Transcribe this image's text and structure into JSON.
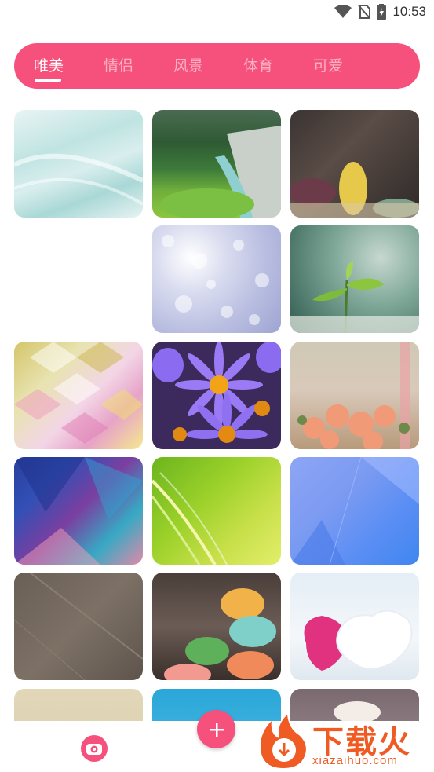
{
  "status_bar": {
    "time": "10:53",
    "icons": [
      "wifi-icon",
      "no-sim-icon",
      "battery-charging-icon"
    ]
  },
  "tabs": [
    {
      "label": "唯美",
      "active": true
    },
    {
      "label": "情侣",
      "active": false
    },
    {
      "label": "风景",
      "active": false
    },
    {
      "label": "体育",
      "active": false
    },
    {
      "label": "可爱",
      "active": false
    }
  ],
  "colors": {
    "accent": "#f6517c",
    "watermark": "#f05a23"
  },
  "wallpapers": [
    "teal-silk-wallpaper",
    "river-valley-wallpaper",
    "macarons-wallpaper",
    "bokeh-lavender-wallpaper",
    "green-sprout-wallpaper",
    "geometric-mosaic-wallpaper",
    "purple-asters-wallpaper",
    "rose-bouquet-wallpaper",
    "blue-purple-polygon-wallpaper",
    "green-yellow-wave-wallpaper",
    "blue-triangle-wallpaper",
    "brown-texture-wallpaper",
    "macarons-pile-wallpaper",
    "pink-heart-mitten-wallpaper",
    "beige-blur-wallpaper",
    "sky-blue-wallpaper",
    "coffee-mug-wallpaper"
  ],
  "bottom_bar": {
    "camera_icon": "camera-icon",
    "add_icon": "plus-icon"
  },
  "watermark": {
    "cn": "下载火",
    "en": "xiazaihuo.com"
  }
}
